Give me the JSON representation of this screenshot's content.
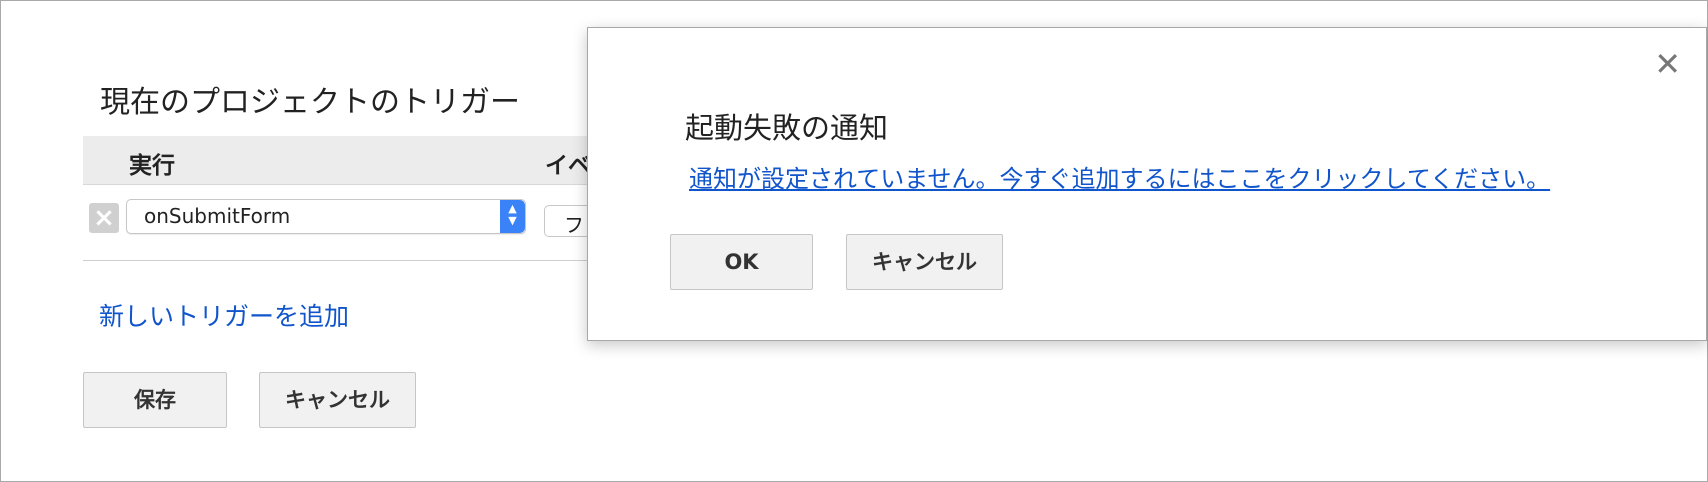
{
  "trigger_dialog": {
    "title": "現在のプロジェクトのトリガー",
    "table": {
      "columns": [
        "実行",
        "イベ"
      ],
      "rows": [
        {
          "function": "onSubmitForm",
          "event_source": "フ"
        }
      ]
    },
    "add_trigger_link": "新しいトリガーを追加",
    "save_label": "保存",
    "cancel_label": "キャンセル"
  },
  "notify_dialog": {
    "close_symbol": "✕",
    "title": "起動失敗の通知",
    "link_text": "通知が設定されていません。今すぐ追加するにはここをクリックしてください。",
    "ok_label": "OK",
    "cancel_label": "キャンセル"
  },
  "icons": {
    "delete": "close-icon",
    "select_arrows": "updown-chevron-icon"
  },
  "colors": {
    "link": "#1155cc",
    "select_accent": "#3a82f7",
    "header_bg": "#ececec",
    "button_bg": "#f1f1f1"
  }
}
